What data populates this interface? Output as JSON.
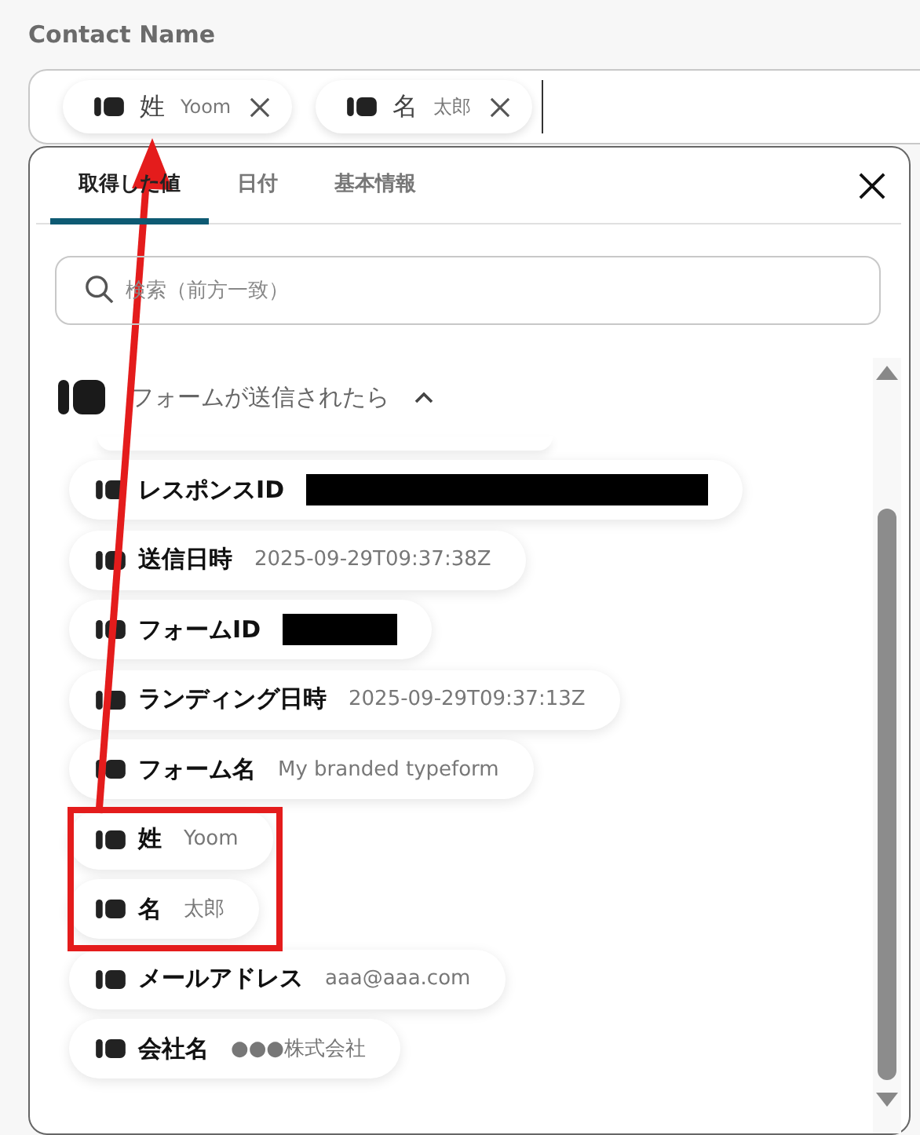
{
  "field": {
    "label": "Contact Name",
    "chips": [
      {
        "label": "姓",
        "value": "Yoom"
      },
      {
        "label": "名",
        "value": "太郎"
      }
    ]
  },
  "panel": {
    "tabs": [
      {
        "label": "取得した値",
        "selected": true
      },
      {
        "label": "日付",
        "selected": false
      },
      {
        "label": "基本情報",
        "selected": false
      }
    ],
    "search": {
      "placeholder": "検索（前方一致）"
    },
    "group": {
      "title": "フォームが送信されたら",
      "expanded": true
    },
    "items": [
      {
        "kind": "masklong",
        "label": "レスポンスID"
      },
      {
        "kind": "text",
        "label": "送信日時",
        "value": "2025-09-29T09:37:38Z"
      },
      {
        "kind": "maskshort",
        "label": "フォームID"
      },
      {
        "kind": "text",
        "label": "ランディング日時",
        "value": "2025-09-29T09:37:13Z"
      },
      {
        "kind": "text",
        "label": "フォーム名",
        "value": "My branded typeform"
      },
      {
        "kind": "text",
        "label": "姓",
        "value": "Yoom"
      },
      {
        "kind": "text",
        "label": "名",
        "value": "太郎"
      },
      {
        "kind": "text",
        "label": "メールアドレス",
        "value": "aaa@aaa.com"
      },
      {
        "kind": "text",
        "label": "会社名",
        "value": "●●●株式会社"
      }
    ]
  }
}
